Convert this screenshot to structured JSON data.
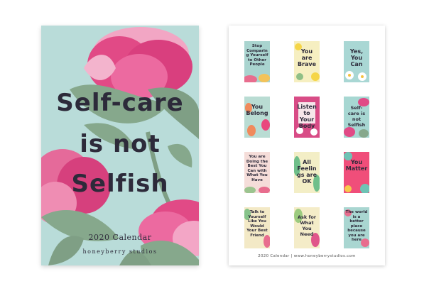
{
  "cover": {
    "title_line1": "Self-care",
    "title_line2": "is not",
    "title_line3": "Selfish",
    "year_label": "2020 Calendar",
    "brand": "honeyberry studios"
  },
  "back": {
    "months": [
      {
        "text": "Stop Comparing Yourself to Other People",
        "bg": "#a9d4cf"
      },
      {
        "text": "You are Brave",
        "bg": "#f6efc1"
      },
      {
        "text": "Yes, You Can",
        "bg": "#a9d7d4"
      },
      {
        "text": "You Belong",
        "bg": "#b9dcd3"
      },
      {
        "text": "Listen to Your Body",
        "bg": "#d84c86"
      },
      {
        "text": "Self-care is not Selfish",
        "bg": "#a7d7d2"
      },
      {
        "text": "You are Doing the Best You Can with What You Have",
        "bg": "#f5ddd9"
      },
      {
        "text": "All Feelings are OK",
        "bg": "#f3eec6"
      },
      {
        "text": "You Matter",
        "bg": "#f04e7a"
      },
      {
        "text": "Talk to Yourself Like You Would Your Best Friend",
        "bg": "#f3e9c6"
      },
      {
        "text": "Ask for What You Need",
        "bg": "#f4ecc8"
      },
      {
        "text": "The world is a better place because you are here",
        "bg": "#a9d6d1"
      }
    ],
    "footer": "2020 Calendar | www.honeyberrystudios.com"
  },
  "colors": {
    "cover_bg": "#b9dcd9",
    "petal_pink": "#e14a86",
    "petal_light": "#f2a6c4",
    "leaf_green": "#86a88c",
    "ink": "#2d2a3a"
  }
}
